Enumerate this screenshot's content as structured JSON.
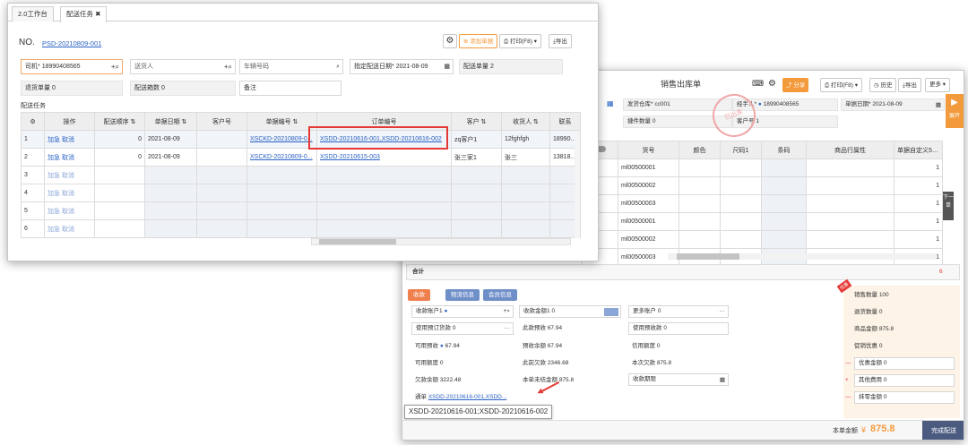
{
  "back": {
    "title": "销售出库单",
    "toolbar": {
      "share": "分享",
      "print": "打印(F8)",
      "history": "历史",
      "export": "导出",
      "more": "更多"
    },
    "stamp": "已出库",
    "header": {
      "warehouse_label": "发货仓库*",
      "warehouse_value": "cc001",
      "handler_label": "经手人*",
      "handler_value": "18990408565",
      "date_label": "单据日期*",
      "date_value": "2021-08-09",
      "remark_label": "摘要",
      "pieces_label": "捷件数量",
      "pieces_value": "0",
      "account_label": "客户号",
      "account_value": "1",
      "expand": "展开"
    },
    "grid": {
      "headers": [
        "",
        "货号",
        "颜色",
        "尺码1",
        "条码",
        "商品行属性",
        "单据自定义5(字段)"
      ],
      "rows": [
        "ml00500001",
        "ml00500002",
        "ml00500003",
        "ml00500001",
        "ml00500002",
        "ml00500003"
      ],
      "last_col": "1",
      "total_label": "合计",
      "total_value": "6"
    },
    "side_tab": "下一单",
    "tabs": [
      "收款",
      "物流信息",
      "会员信息"
    ],
    "payment": {
      "account_label": "收款账户1",
      "amount_label": "收款金额1",
      "amount_value": "0",
      "more_label": "更多账户",
      "more_value": "0",
      "prepay_label": "使用预订货款",
      "prepay_value": "0",
      "this_prepay_label": "此款预收",
      "this_prepay_value": "67.94",
      "use_prepay_label": "使用预收款",
      "use_prepay_value": "0",
      "avail_label": "可用预收",
      "avail_value": "67.94",
      "prepay_total_label": "预收余额",
      "prepay_total_value": "67.94",
      "credit_label": "信用额度",
      "credit_value": "0",
      "avail_credit_label": "可用额度",
      "avail_credit_value": "0",
      "this_owe_label": "此前欠款",
      "this_owe_value": "2346.68",
      "this_time_label": "本次欠款",
      "this_time_value": "875.8",
      "owe_total_label": "欠款余额",
      "owe_total_value": "3222.48",
      "unsettled_label": "本单未结金额",
      "unsettled_value": "875.8",
      "deadline_label": "收款期限",
      "order_label": "通单",
      "order_value": "XSDD-20210616-001,XSDD..."
    },
    "summary": {
      "sales_qty_label": "销售数量",
      "sales_qty_value": "100",
      "return_qty_label": "退货数量",
      "return_qty_value": "0",
      "goods_amount_label": "商品金额",
      "goods_amount_value": "875.8",
      "promo_label": "促销优惠",
      "promo_value": "0",
      "discount_label": "优惠金额",
      "discount_value": "0",
      "other_fee_label": "其他费用",
      "other_fee_value": "0",
      "erase_label": "抹零金额",
      "erase_value": "0",
      "badge": "优惠"
    },
    "footer": {
      "total_label": "本单金额",
      "currency": "¥",
      "total_value": "875.8",
      "complete": "完成配送"
    },
    "tooltip": "XSDD-20210616-001;XSDD-20210616-002"
  },
  "front": {
    "tabs": [
      "2.0工作台",
      "配送任务"
    ],
    "no_label": "NO.",
    "no_value": "PSD-20210809-001",
    "toolbar": {
      "add": "添加单据",
      "print": "打印(F8)",
      "export": "导出"
    },
    "form": {
      "driver_label": "司机*",
      "driver_value": "18990408565",
      "deliverer_placeholder": "送货人",
      "plate_placeholder": "车辆号码",
      "date_label": "指定配送日期*",
      "date_value": "2021-08-09",
      "count_label": "配送单量",
      "count_value": "2",
      "return_label": "退货单量",
      "return_value": "0",
      "boxes_label": "配送箱数",
      "boxes_value": "0",
      "remark_placeholder": "备注"
    },
    "section_title": "配送任务",
    "grid": {
      "headers": [
        "",
        "操作",
        "配送顺序",
        "单据日期",
        "客户号",
        "单据编号",
        "订单编号",
        "客户",
        "收货人",
        "联系"
      ],
      "rows": [
        {
          "idx": "1",
          "ops": "加急 取消",
          "order": "0",
          "date": "2021-08-09",
          "cust_no": "",
          "doc": "XSCKD-20210809-0...",
          "orders": "XSDD-20210616-001,XSDD-20210616-002",
          "customer": "zq客户1",
          "receiver": "12fghfgh",
          "phone": "1899040"
        },
        {
          "idx": "2",
          "ops": "加急 取消",
          "order": "0",
          "date": "2021-08-09",
          "cust_no": "",
          "doc": "XSCKD-20210809-0...",
          "orders": "XSDD-20210615-003",
          "customer": "张三家1",
          "receiver": "张三",
          "phone": "1381888"
        },
        {
          "idx": "3",
          "ops": "加急 取消"
        },
        {
          "idx": "4",
          "ops": "加急 取消"
        },
        {
          "idx": "5",
          "ops": "加急 取消"
        },
        {
          "idx": "6",
          "ops": "加急 取消"
        }
      ]
    }
  },
  "colors": {
    "accent": "#f39a3c",
    "link": "#2b63c6",
    "highlight": "#e53935",
    "tab_orange": "#ef7f4d",
    "tab_blue": "#6f8fc9"
  },
  "icons": [
    "gear-icon",
    "add-icon",
    "print-icon",
    "export-icon",
    "search-icon",
    "calendar-icon",
    "close-icon",
    "history-icon",
    "keyboard-icon",
    "play-icon"
  ]
}
